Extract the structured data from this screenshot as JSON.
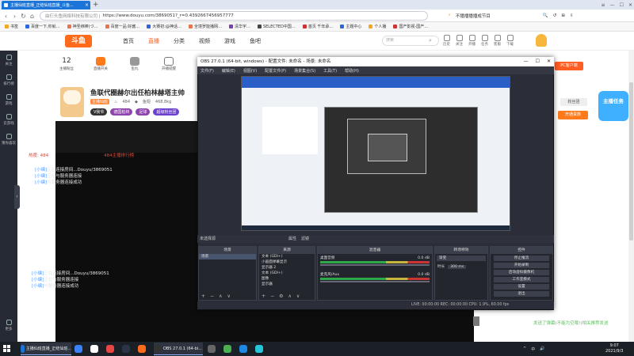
{
  "browser": {
    "tab_title": "主播仙班直播_正结仙班直播_斗鱼...",
    "url_prefix": "由仨头鱼网络科技有限公司 |",
    "url": "https://www.douyu.com/3869051?_r=0.4392667456957777",
    "right_status": "不播播播播成节目",
    "bookmarks": [
      "书签",
      "百度一下,你就…",
      "神圣绑棒(づ…",
      "百度一品:好酱…",
      "大赛初:@神话…",
      "全境罗能播网…",
      "清华宇…",
      "SELECTED中国…",
      "首页 千年承…",
      "主题中心",
      "个人播",
      "国产影视-国产…"
    ]
  },
  "site": {
    "logo": "斗鱼",
    "nav": [
      "首页",
      "直播",
      "分类",
      "视频",
      "游戏",
      "鱼吧"
    ],
    "search_placeholder": "搜索",
    "top_icons": [
      "历史",
      "关注",
      "开播",
      "任务",
      "客服",
      "下载"
    ]
  },
  "sidebar": [
    "关注",
    "排行榜",
    "游戏",
    "云游戏",
    "猜你喜欢",
    "更多"
  ],
  "stats": [
    {
      "n": "12",
      "label": "主播粉丝"
    },
    {
      "n": "",
      "label": "直播开关"
    },
    {
      "n": "",
      "label": "鱼丸"
    },
    {
      "n": "",
      "label": "开播提醒"
    },
    {
      "n": "",
      "label": "星光"
    }
  ],
  "streamer": {
    "name": "鱼联代圈赫尔出任柏林赫塔主帅",
    "meta": [
      "主播仙班",
      "484",
      "鱼翅",
      "468.8kg"
    ],
    "tags": [
      "V我爷",
      "德国柏林",
      "足球",
      "超级粉丝团"
    ]
  },
  "chat": {
    "hot_label": "热度: 484",
    "rank_label": "484主播排行榜",
    "lines1": [
      {
        "sys": "[小编]",
        "text": "正在连接房间...Douyu/3869051"
      },
      {
        "sys": "[小编]",
        "text": "正在与服务器连接"
      },
      {
        "sys": "[小编]",
        "text": "与服务器连接成功"
      }
    ],
    "lines2": [
      {
        "sys": "[小编]",
        "text": "正在连接房间...Douyu/3869051"
      },
      {
        "sys": "[小编]",
        "text": "正在与服务器连接"
      },
      {
        "sys": "[小编]",
        "text": "与服务器连接成功"
      }
    ]
  },
  "right": {
    "pc_btn": "PC客户端",
    "btn1": "粉丝团",
    "btn2": "开通贵族",
    "task_badge": "主播任务",
    "danmu": "发送了弹幕(不能为空哦!)相关推荐发送"
  },
  "obs": {
    "title": "OBS 27.0.1 (64-bit, windows) - 配置文件: 未命名 - 场景: 未命名",
    "menu": [
      "文件(F)",
      "编辑(E)",
      "视图(V)",
      "配置文件(P)",
      "场景集合(S)",
      "工具(T)",
      "帮助(H)"
    ],
    "status1": "未选择源",
    "lock_btns": [
      "属性",
      "滤镜"
    ],
    "docks": {
      "scenes": "场景",
      "sources": "来源",
      "mixer": "混音器",
      "transitions": "转场特效",
      "controls": "控件"
    },
    "scene_items": [
      "场景"
    ],
    "source_items": [
      "文本 (GDI+)",
      "小画面弹幕显示",
      "显示器 2",
      "文本 (GDI+)",
      "图像",
      "显示器"
    ],
    "mixer": [
      {
        "name": "桌面音频",
        "db": "0.0 dB"
      },
      {
        "name": "麦克风/Aux",
        "db": "0.0 dB"
      }
    ],
    "transition_type": "渐变",
    "transition_duration_label": "时长",
    "transition_duration": "300 ms",
    "controls": [
      "停止推流",
      "开始录制",
      "启动虚拟摄像机",
      "工作室模式",
      "设置",
      "退出"
    ],
    "status2": "LIVE: 00:00:00   REC: 00:00:00   CPU: 1.9%, 60.00 fps"
  },
  "taskbar": {
    "apps": [
      "主播仙班直播_正结仙班...",
      "OBS 27.0.1 (64-bi..."
    ],
    "time": "9:07",
    "date": "2021/9/3",
    "tray": [
      "^",
      "中",
      "🔊"
    ]
  }
}
